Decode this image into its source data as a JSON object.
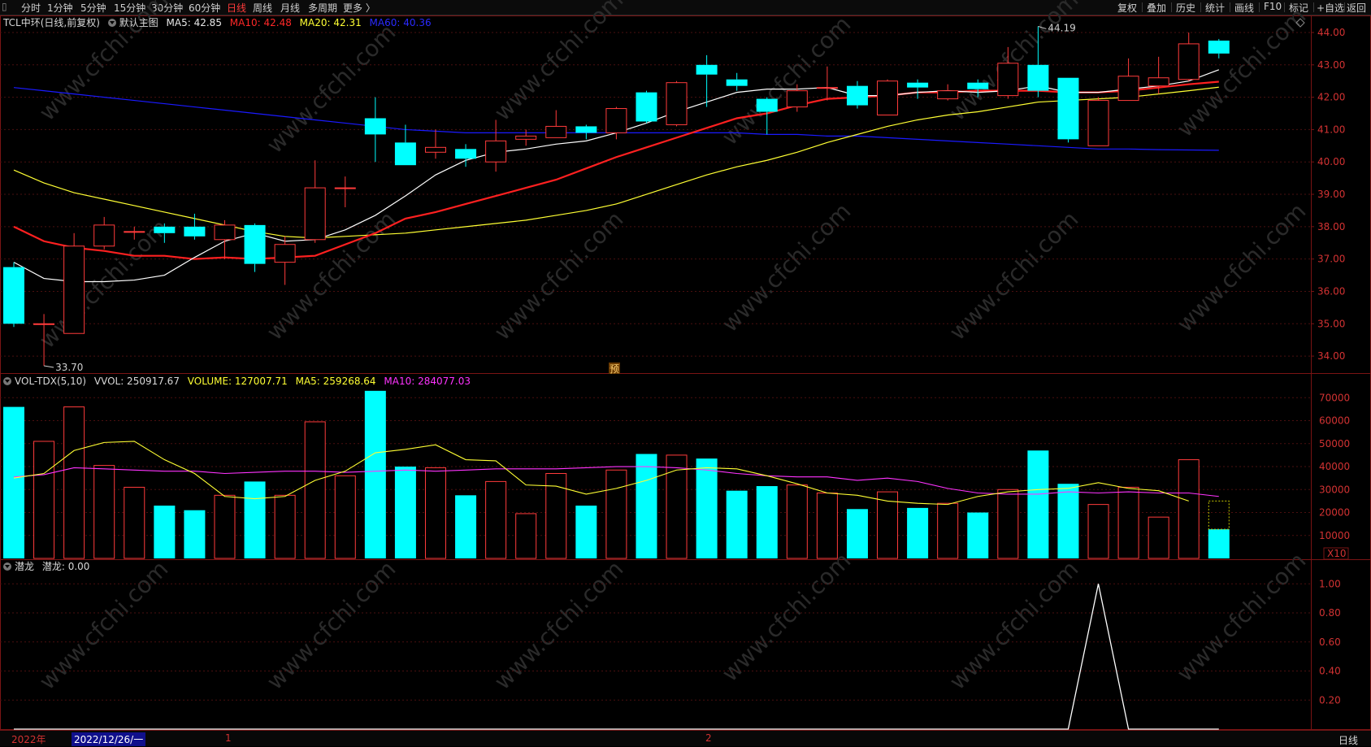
{
  "toolbar": {
    "left_items": [
      "分时",
      "1分钟",
      "5分钟",
      "15分钟",
      "30分钟",
      "60分钟",
      "日线",
      "周线",
      "月线",
      "多周期",
      "更多 〉"
    ],
    "active_item": "日线",
    "right_items": [
      "复权",
      "叠加",
      "历史",
      "统计",
      "画线",
      "F10",
      "标记",
      "+自选",
      "返回"
    ]
  },
  "main_legend": {
    "title": "TCL中环(日线,前复权)",
    "template": "默认主图",
    "ma5": "MA5: 42.85",
    "ma10": "MA10: 42.48",
    "ma20": "MA20: 42.31",
    "ma60": "MA60: 40.36"
  },
  "vol_legend": {
    "name": "VOL-TDX(5,10)",
    "vvol": "VVOL: 250917.67",
    "volume": "VOLUME: 127007.71",
    "ma5": "MA5: 259268.64",
    "ma10": "MA10: 284077.03"
  },
  "ind_legend": {
    "name": "潜龙",
    "value": "潜龙: 0.00"
  },
  "annotations": {
    "high": "44.19",
    "low": "33.70",
    "pre_marker": "预"
  },
  "bottom": {
    "year": "2022年",
    "date": "2022/12/26/一",
    "month1": "1",
    "month2": "2",
    "period": "日线"
  },
  "vol_unit": "X10",
  "watermark": "www.cfchi.com",
  "colors": {
    "up": "#ff3b3b",
    "down": "#00ffff",
    "ma5": "#ffffff",
    "ma10": "#ff2020",
    "ma20": "#ffff33",
    "ma60": "#1a1aff",
    "vma5": "#ffff33",
    "vma10": "#ff33ff",
    "grid": "#4a0f0f"
  },
  "chart_data": {
    "type": "candlestick",
    "price_axis": {
      "ticks": [
        34.0,
        35.0,
        36.0,
        37.0,
        38.0,
        39.0,
        40.0,
        41.0,
        42.0,
        43.0,
        44.0
      ],
      "range": [
        33.5,
        44.1
      ]
    },
    "candles": [
      {
        "o": 36.75,
        "c": 35.0,
        "h": 36.9,
        "l": 34.9,
        "v": 66000
      },
      {
        "o": 35.0,
        "c": 35.0,
        "h": 35.3,
        "l": 33.7,
        "v": 51000
      },
      {
        "o": 34.7,
        "c": 37.4,
        "h": 37.8,
        "l": 34.7,
        "v": 66000
      },
      {
        "o": 37.4,
        "c": 38.05,
        "h": 38.3,
        "l": 37.3,
        "v": 40500
      },
      {
        "o": 37.85,
        "c": 37.85,
        "h": 38.0,
        "l": 37.6,
        "v": 31000
      },
      {
        "o": 38.0,
        "c": 37.8,
        "h": 38.1,
        "l": 37.5,
        "v": 23000
      },
      {
        "o": 38.0,
        "c": 37.7,
        "h": 38.4,
        "l": 37.6,
        "v": 21000
      },
      {
        "o": 37.6,
        "c": 38.05,
        "h": 38.2,
        "l": 37.0,
        "v": 27500
      },
      {
        "o": 38.05,
        "c": 36.85,
        "h": 38.1,
        "l": 36.6,
        "v": 33500
      },
      {
        "o": 36.9,
        "c": 37.45,
        "h": 37.7,
        "l": 36.2,
        "v": 27500
      },
      {
        "o": 37.6,
        "c": 39.2,
        "h": 40.05,
        "l": 37.5,
        "v": 59500
      },
      {
        "o": 39.2,
        "c": 39.2,
        "h": 39.55,
        "l": 38.6,
        "v": 36000
      },
      {
        "o": 41.35,
        "c": 40.85,
        "h": 42.0,
        "l": 40.0,
        "v": 73000
      },
      {
        "o": 40.6,
        "c": 39.9,
        "h": 41.15,
        "l": 39.9,
        "v": 40000
      },
      {
        "o": 40.3,
        "c": 40.45,
        "h": 41.0,
        "l": 40.1,
        "v": 39500
      },
      {
        "o": 40.4,
        "c": 40.1,
        "h": 40.55,
        "l": 39.85,
        "v": 27500
      },
      {
        "o": 40.0,
        "c": 40.65,
        "h": 41.3,
        "l": 39.7,
        "v": 33500
      },
      {
        "o": 40.7,
        "c": 40.8,
        "h": 41.0,
        "l": 40.5,
        "v": 19500
      },
      {
        "o": 40.75,
        "c": 41.1,
        "h": 41.6,
        "l": 40.75,
        "v": 37000
      },
      {
        "o": 41.1,
        "c": 40.9,
        "h": 41.15,
        "l": 40.7,
        "v": 23000
      },
      {
        "o": 40.9,
        "c": 41.65,
        "h": 41.7,
        "l": 40.7,
        "v": 38500
      },
      {
        "o": 42.15,
        "c": 41.25,
        "h": 42.2,
        "l": 41.2,
        "v": 45500
      },
      {
        "o": 41.15,
        "c": 42.45,
        "h": 42.5,
        "l": 41.1,
        "v": 45000
      },
      {
        "o": 43.0,
        "c": 42.7,
        "h": 43.3,
        "l": 41.7,
        "v": 43500
      },
      {
        "o": 42.55,
        "c": 42.35,
        "h": 42.75,
        "l": 42.2,
        "v": 29500
      },
      {
        "o": 41.95,
        "c": 41.55,
        "h": 42.0,
        "l": 40.85,
        "v": 31500
      },
      {
        "o": 41.7,
        "c": 42.2,
        "h": 42.4,
        "l": 41.55,
        "v": 32000
      },
      {
        "o": 42.3,
        "c": 42.3,
        "h": 42.95,
        "l": 41.9,
        "v": 28500
      },
      {
        "o": 42.35,
        "c": 41.75,
        "h": 42.5,
        "l": 41.65,
        "v": 21500
      },
      {
        "o": 41.45,
        "c": 42.5,
        "h": 42.55,
        "l": 41.45,
        "v": 29000
      },
      {
        "o": 42.45,
        "c": 42.3,
        "h": 42.55,
        "l": 41.95,
        "v": 22000
      },
      {
        "o": 41.95,
        "c": 42.2,
        "h": 42.4,
        "l": 41.9,
        "v": 24000
      },
      {
        "o": 42.45,
        "c": 42.25,
        "h": 42.55,
        "l": 42.0,
        "v": 20000
      },
      {
        "o": 42.05,
        "c": 43.05,
        "h": 43.55,
        "l": 41.95,
        "v": 30000
      },
      {
        "o": 43.0,
        "c": 42.2,
        "h": 44.19,
        "l": 42.0,
        "v": 47000
      },
      {
        "o": 42.6,
        "c": 40.7,
        "h": 42.6,
        "l": 40.6,
        "v": 32500
      },
      {
        "o": 40.5,
        "c": 41.9,
        "h": 42.0,
        "l": 40.5,
        "v": 23500
      },
      {
        "o": 41.9,
        "c": 42.65,
        "h": 43.2,
        "l": 41.9,
        "v": 31000
      },
      {
        "o": 42.35,
        "c": 42.6,
        "h": 43.25,
        "l": 42.1,
        "v": 18000
      },
      {
        "o": 42.55,
        "c": 43.65,
        "h": 44.0,
        "l": 42.5,
        "v": 43000
      },
      {
        "o": 43.75,
        "c": 43.35,
        "h": 43.8,
        "l": 43.2,
        "v": 12700
      }
    ],
    "ma5": [
      36.9,
      36.4,
      36.3,
      36.3,
      36.35,
      36.5,
      37.05,
      37.55,
      37.8,
      37.55,
      37.6,
      37.9,
      38.35,
      38.95,
      39.6,
      40.05,
      40.3,
      40.4,
      40.55,
      40.65,
      40.9,
      41.2,
      41.55,
      41.85,
      42.15,
      42.25,
      42.25,
      42.3,
      42.05,
      42.05,
      42.15,
      42.2,
      42.15,
      42.2,
      42.35,
      42.15,
      42.15,
      42.25,
      42.35,
      42.5,
      42.85
    ],
    "ma10": [
      38.0,
      37.55,
      37.35,
      37.25,
      37.1,
      37.1,
      37.0,
      37.05,
      37.0,
      37.05,
      37.1,
      37.45,
      37.8,
      38.25,
      38.45,
      38.7,
      38.95,
      39.2,
      39.45,
      39.8,
      40.15,
      40.45,
      40.75,
      41.05,
      41.35,
      41.5,
      41.75,
      41.95,
      42.0,
      42.05,
      42.15,
      42.15,
      42.2,
      42.2,
      42.2,
      42.15,
      42.15,
      42.2,
      42.3,
      42.4,
      42.48
    ],
    "ma20": [
      39.75,
      39.35,
      39.05,
      38.85,
      38.65,
      38.45,
      38.25,
      38.05,
      37.85,
      37.7,
      37.65,
      37.7,
      37.75,
      37.8,
      37.9,
      38.0,
      38.1,
      38.2,
      38.35,
      38.5,
      38.7,
      39.0,
      39.3,
      39.6,
      39.85,
      40.05,
      40.3,
      40.6,
      40.85,
      41.1,
      41.3,
      41.45,
      41.55,
      41.7,
      41.85,
      41.9,
      41.95,
      42.0,
      42.1,
      42.2,
      42.31
    ],
    "ma60": [
      42.3,
      42.2,
      42.1,
      42.0,
      41.9,
      41.8,
      41.7,
      41.6,
      41.5,
      41.4,
      41.3,
      41.2,
      41.1,
      41.0,
      40.95,
      40.9,
      40.9,
      40.9,
      40.9,
      40.9,
      40.9,
      40.9,
      40.9,
      40.9,
      40.9,
      40.85,
      40.85,
      40.8,
      40.8,
      40.75,
      40.7,
      40.65,
      40.6,
      40.55,
      40.5,
      40.45,
      40.4,
      40.4,
      40.38,
      40.37,
      40.36
    ],
    "vol_axis": {
      "ticks": [
        10000,
        20000,
        30000,
        40000,
        50000,
        60000,
        70000
      ],
      "max": 74000
    },
    "vol_ma5": [
      35000,
      37000,
      47000,
      50500,
      51000,
      43000,
      37000,
      27000,
      26000,
      27000,
      34000,
      38000,
      46000,
      47500,
      49500,
      43000,
      42500,
      32000,
      31500,
      28000,
      30500,
      34000,
      38500,
      39500,
      39000,
      36000,
      32500,
      28500,
      27500,
      25000,
      24000,
      23500,
      27000,
      29000,
      30000,
      30500,
      33000,
      30500,
      29500,
      25000
    ],
    "vol_ma10": [
      35500,
      36500,
      39500,
      39000,
      38500,
      38000,
      38000,
      37000,
      37500,
      38000,
      38000,
      37500,
      38000,
      38500,
      38000,
      38500,
      39000,
      39000,
      39000,
      39500,
      40000,
      40000,
      39500,
      38500,
      37000,
      36000,
      35500,
      35500,
      34000,
      35000,
      33500,
      30500,
      28500,
      28000,
      28000,
      29000,
      28500,
      29000,
      28500,
      28500,
      27000
    ],
    "indicator": {
      "ticks": [
        0.2,
        0.4,
        0.6,
        0.8,
        1.0
      ],
      "values": [
        0,
        0,
        0,
        0,
        0,
        0,
        0,
        0,
        0,
        0,
        0,
        0,
        0,
        0,
        0,
        0,
        0,
        0,
        0,
        0,
        0,
        0,
        0,
        0,
        0,
        0,
        0,
        0,
        0,
        0,
        0,
        0,
        0,
        0,
        0,
        0,
        1,
        0,
        0,
        0,
        0
      ]
    }
  }
}
